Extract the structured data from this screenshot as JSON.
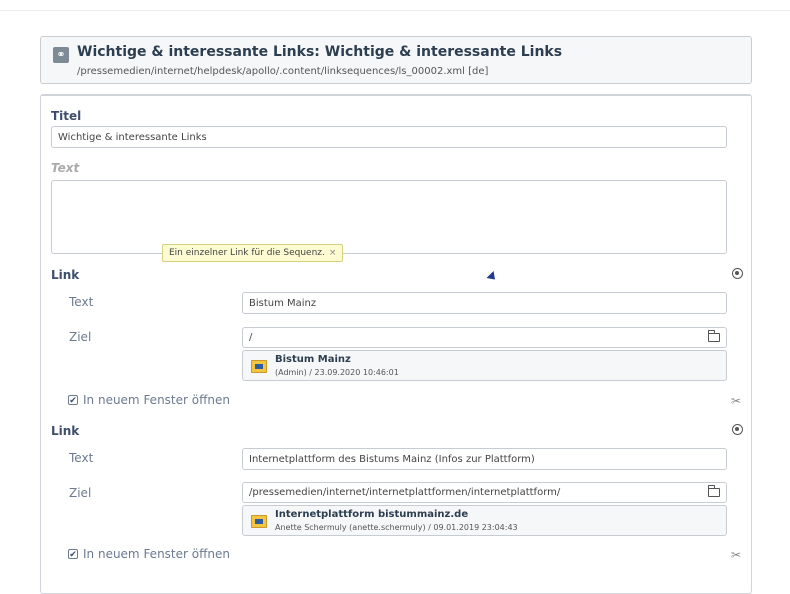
{
  "header": {
    "icon": "link-icon",
    "title": "Wichtige & interessante Links: Wichtige & interessante Links",
    "path": "/pressemedien/internet/helpdesk/apollo/.content/linksequences/ls_00002.xml [de]"
  },
  "form": {
    "titel_label": "Titel",
    "titel_value": "Wichtige & interessante Links",
    "text_label": "Text",
    "text_value": "",
    "tooltip": "Ein einzelner Link für die Sequenz.",
    "tooltip_close": "×",
    "links": [
      {
        "section_label": "Link",
        "text_label": "Text",
        "text_value": "Bistum Mainz",
        "ziel_label": "Ziel",
        "ziel_value": "/",
        "resource_title": "Bistum Mainz",
        "resource_meta": "(Admin) / 23.09.2020 10:46:01",
        "new_window_label": "In neuem Fenster öffnen",
        "new_window_checked": true
      },
      {
        "section_label": "Link",
        "text_label": "Text",
        "text_value": "Internetplattform des Bistums Mainz (Infos zur Plattform)",
        "ziel_label": "Ziel",
        "ziel_value": "/pressemedien/internet/internetplattformen/internetplattform/",
        "resource_title": "Internetplattform bistummainz.de",
        "resource_meta": "Anette Schermuly (anette.schermuly) / 09.01.2019 23:04:43",
        "new_window_label": "In neuem Fenster öffnen",
        "new_window_checked": true
      }
    ]
  },
  "icons": {
    "check": "✔",
    "scissors": "✂",
    "link": "🔗"
  }
}
